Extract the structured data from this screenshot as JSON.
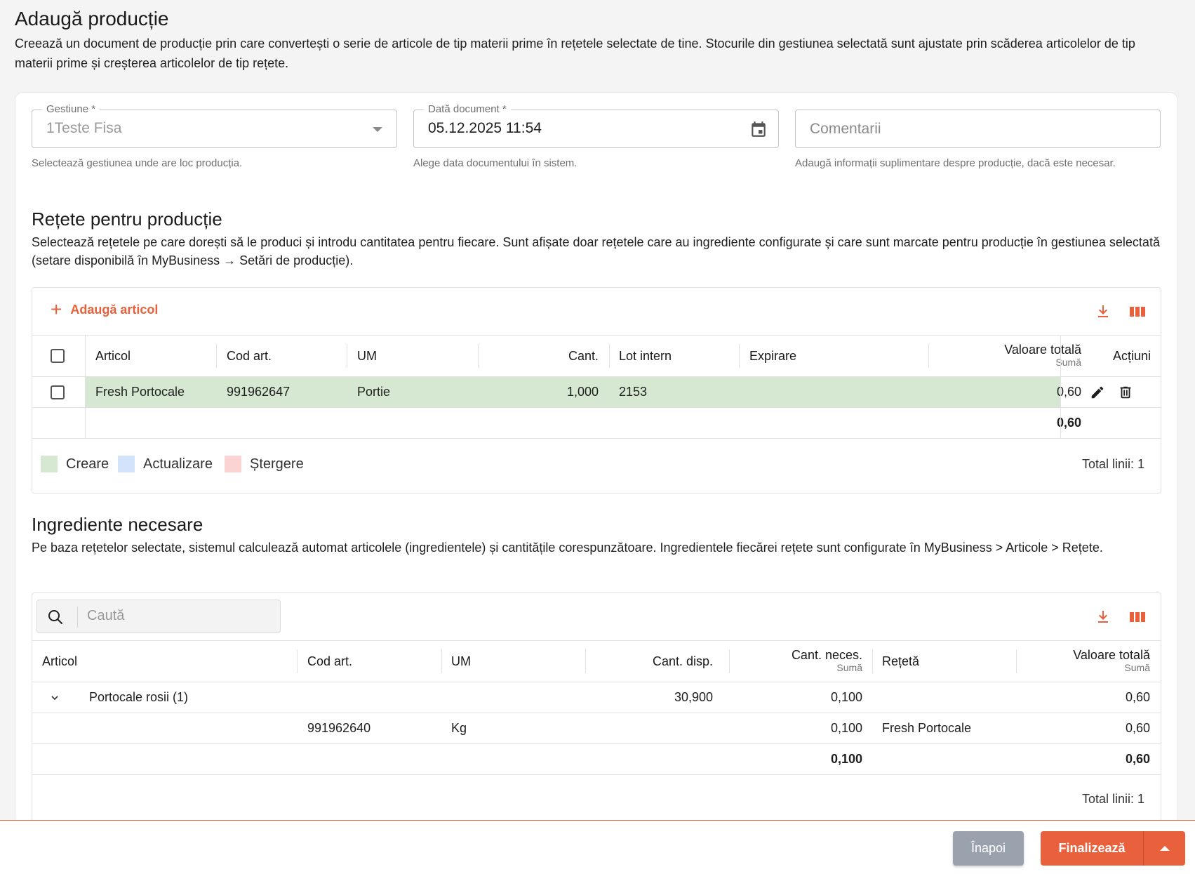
{
  "header": {
    "title": "Adaugă producție",
    "description": "Creează un document de producție prin care convertești o serie de articole de tip materii prime în rețetele selectate de tine. Stocurile din gestiunea selectată sunt ajustate prin scăderea articolelor de tip materii prime și creșterea articolelor de tip rețete."
  },
  "form": {
    "gestiune": {
      "label": "Gestiune *",
      "value": "1Teste Fisa",
      "help": "Selectează gestiunea unde are loc producția."
    },
    "data_document": {
      "label": "Dată document *",
      "value": "05.12.2025 11:54",
      "help": "Alege data documentului în sistem."
    },
    "comentarii": {
      "placeholder": "Comentarii",
      "help": "Adaugă informații suplimentare despre producție, dacă este necesar."
    }
  },
  "recipes": {
    "title": "Rețete pentru producție",
    "description": "Selectează rețetele pe care dorești să le produci și introdu cantitatea pentru fiecare. Sunt afișate doar rețetele care au ingrediente configurate și care sunt marcate pentru producție în gestiunea selectată (setare disponibilă în MyBusiness → Setări de producție).",
    "add_label": "Adaugă articol",
    "columns": {
      "articol": "Articol",
      "cod": "Cod art.",
      "um": "UM",
      "cant": "Cant.",
      "lot": "Lot intern",
      "expirare": "Expirare",
      "valoare": "Valoare totală",
      "valoare_sub": "Sumă",
      "actiuni": "Acțiuni"
    },
    "rows": [
      {
        "articol": "Fresh Portocale",
        "cod": "991962647",
        "um": "Portie",
        "cant": "1,000",
        "lot": "2153",
        "expirare": "",
        "valoare": "0,60"
      }
    ],
    "total_valoare": "0,60",
    "legend": [
      {
        "label": "Creare",
        "color": "#d6e7d2"
      },
      {
        "label": "Actualizare",
        "color": "#d3e3fb"
      },
      {
        "label": "Ștergere",
        "color": "#fbd3d3"
      }
    ],
    "total_lines": "Total linii: 1",
    "row_color": "#d6e7d2"
  },
  "ingredients": {
    "title": "Ingrediente necesare",
    "description": "Pe baza rețetelor selectate, sistemul calculează automat articolele (ingredientele) și cantitățile corespunzătoare. Ingredientele fiecărei rețete sunt configurate în MyBusiness > Articole > Rețete.",
    "search_placeholder": "Caută",
    "columns": {
      "articol": "Articol",
      "cod": "Cod art.",
      "um": "UM",
      "cant_disp": "Cant. disp.",
      "cant_neces": "Cant. neces.",
      "cant_neces_sub": "Sumă",
      "reteta": "Rețetă",
      "valoare": "Valoare totală",
      "valoare_sub": "Sumă"
    },
    "group": {
      "articol": "Portocale rosii (1)",
      "cant_disp": "30,900",
      "cant_neces": "0,100",
      "valoare": "0,60"
    },
    "rows": [
      {
        "cod": "991962640",
        "um": "Kg",
        "cant_neces": "0,100",
        "reteta": "Fresh Portocale",
        "valoare": "0,60"
      }
    ],
    "total_cant_neces": "0,100",
    "total_valoare": "0,60",
    "total_lines": "Total linii: 1"
  },
  "footer": {
    "back_label": "Înapoi",
    "finish_label": "Finalizează"
  },
  "colors": {
    "accent": "#e8603c",
    "back_button": "#9aa3ad"
  },
  "icons": [
    "calendar-icon",
    "download-icon",
    "columns-icon",
    "edit-icon",
    "delete-icon",
    "search-icon",
    "chevron-down-icon",
    "arrow-up-icon"
  ]
}
